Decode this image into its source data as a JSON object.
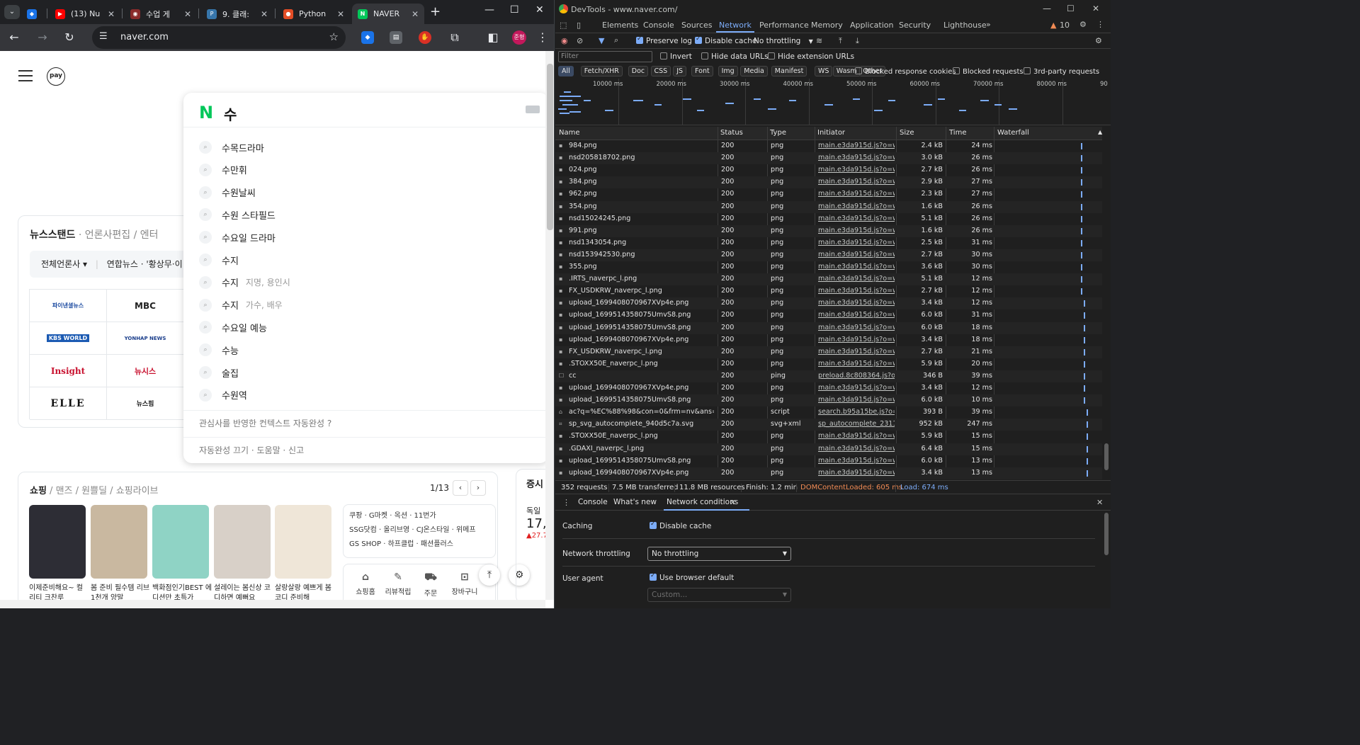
{
  "browser": {
    "tabs": [
      {
        "label": "",
        "favicon_color": "#1a73e8",
        "icon": "gem-icon"
      },
      {
        "label": "(13) Nu",
        "favicon_color": "#ff0000",
        "icon": "youtube-icon"
      },
      {
        "label": "수업 게",
        "favicon_color": "#8a2b2b",
        "icon": "site-icon"
      },
      {
        "label": "9. 클래:",
        "favicon_color": "#3776ab",
        "icon": "python-icon"
      },
      {
        "label": "Python",
        "favicon_color": "#e44d26",
        "icon": "site-icon"
      },
      {
        "label": "NAVER",
        "favicon_color": "#03c75a",
        "icon": "naver-icon"
      }
    ],
    "url": "naver.com",
    "avatar_text": "준형"
  },
  "naver": {
    "pay_logo": "pay",
    "news_title": "뉴스스탠드",
    "news_tab2": "언론사편집",
    "news_tab3": "엔터",
    "press_filter": "전체언론사 ▾",
    "press_ticker": "연합뉴스 · '황상무·이",
    "press": [
      {
        "name": "파이낸셜뉴스",
        "color": "#1b4aa0"
      },
      {
        "name": "MBC",
        "color": "#222"
      },
      {
        "name": "KBS WORLD",
        "color": "#1c5bb3"
      },
      {
        "name": "YONHAP NEWS",
        "color": "#1c3f8c"
      },
      {
        "name": "Insight",
        "color": "#c8102e"
      },
      {
        "name": "뉴시스",
        "color": "#c8102e"
      },
      {
        "name": "ELLE",
        "color": "#111"
      },
      {
        "name": "뉴스핌",
        "color": "#111"
      }
    ],
    "autocomplete": {
      "query": "수",
      "items": [
        {
          "text": "수목드라마",
          "sub": ""
        },
        {
          "text": "수만휘",
          "sub": ""
        },
        {
          "text": "수원날씨",
          "sub": ""
        },
        {
          "text": "수원 스타필드",
          "sub": ""
        },
        {
          "text": "수요일 드라마",
          "sub": ""
        },
        {
          "text": "수지",
          "sub": ""
        },
        {
          "text": "수지",
          "sub": "지명, 용인시"
        },
        {
          "text": "수지",
          "sub": "가수, 배우"
        },
        {
          "text": "수요일 예능",
          "sub": ""
        },
        {
          "text": "수능",
          "sub": ""
        },
        {
          "text": "술집",
          "sub": ""
        },
        {
          "text": "수원역",
          "sub": ""
        }
      ],
      "context_text": "관심사를 반영한 컨텍스트 자동완성 ?",
      "footer": "자동완성 끄기 · 도움말 · 신고"
    },
    "shopping": {
      "tab1": "쇼핑",
      "tab2": "맨즈",
      "tab3": "원쁠딜",
      "tab4": "쇼핑라이브",
      "pager": "1/13",
      "products": [
        {
          "caption": "이제준비해요~ 컬리티 크찬루",
          "color": "#2d2d35"
        },
        {
          "caption": "봄 준비 필수템 리브 1천개 양말",
          "color": "#c9b8a0"
        },
        {
          "caption": "백화점인기BEST 에디션만 초특가",
          "color": "#8fd3c5"
        },
        {
          "caption": "설레이는 봄신상 코디하면 예뻐요",
          "color": "#d8d0c8"
        },
        {
          "caption": "살랑살랑 예쁘게 봄코디 준비해",
          "color": "#efe6d8"
        }
      ],
      "brands_line1": "쿠팡 · G마켓 · 옥션 · 11번가",
      "brands_line2": "SSG닷컴 · 올리브영 · CJ온스타일 · 위메프",
      "brands_line3": "GS SHOP · 하프클럽 · 패션플러스",
      "shortcuts": [
        {
          "label": "쇼핑홈",
          "icon": "home-icon"
        },
        {
          "label": "리뷰적립",
          "icon": "review-icon"
        },
        {
          "label": "주문",
          "icon": "truck-icon"
        },
        {
          "label": "장바구니",
          "icon": "cart-icon"
        }
      ]
    },
    "stock": {
      "title": "증시",
      "label": "독일",
      "value": "17,9",
      "change": "▲27.7"
    }
  },
  "devtools": {
    "title": "DevTools - www.naver.com/",
    "tabs": [
      "Elements",
      "Console",
      "Sources",
      "Network",
      "Performance",
      "Memory",
      "Application",
      "Security",
      "Lighthouse"
    ],
    "active_tab": "Network",
    "warnings": "10",
    "preserve_log": "Preserve log",
    "disable_cache": "Disable cache",
    "throttling": "No throttling",
    "filter_placeholder": "Filter",
    "invert": "Invert",
    "hide_data_urls": "Hide data URLs",
    "hide_ext_urls": "Hide extension URLs",
    "filter_types": [
      "All",
      "Fetch/XHR",
      "Doc",
      "CSS",
      "JS",
      "Font",
      "Img",
      "Media",
      "Manifest",
      "WS",
      "Wasm",
      "Other"
    ],
    "blocked_cookies": "Blocked response cookies",
    "blocked_requests": "Blocked requests",
    "third_party": "3rd-party requests",
    "timeline_labels": [
      "10000 ms",
      "20000 ms",
      "30000 ms",
      "40000 ms",
      "50000 ms",
      "60000 ms",
      "70000 ms",
      "80000 ms",
      "90"
    ],
    "columns": [
      "Name",
      "Status",
      "Type",
      "Initiator",
      "Size",
      "Time",
      "Waterfall"
    ],
    "rows": [
      {
        "name": "984.png",
        "status": "200",
        "type": "png",
        "initiator": "main.e3da915d.js?o=w...",
        "size": "2.4 kB",
        "time": "24 ms"
      },
      {
        "name": "nsd205818702.png",
        "status": "200",
        "type": "png",
        "initiator": "main.e3da915d.js?o=w...",
        "size": "3.0 kB",
        "time": "26 ms"
      },
      {
        "name": "024.png",
        "status": "200",
        "type": "png",
        "initiator": "main.e3da915d.js?o=w...",
        "size": "2.7 kB",
        "time": "26 ms"
      },
      {
        "name": "384.png",
        "status": "200",
        "type": "png",
        "initiator": "main.e3da915d.js?o=w...",
        "size": "2.9 kB",
        "time": "27 ms"
      },
      {
        "name": "962.png",
        "status": "200",
        "type": "png",
        "initiator": "main.e3da915d.js?o=w...",
        "size": "2.3 kB",
        "time": "27 ms"
      },
      {
        "name": "354.png",
        "status": "200",
        "type": "png",
        "initiator": "main.e3da915d.js?o=w...",
        "size": "1.6 kB",
        "time": "26 ms"
      },
      {
        "name": "nsd15024245.png",
        "status": "200",
        "type": "png",
        "initiator": "main.e3da915d.js?o=w...",
        "size": "5.1 kB",
        "time": "26 ms"
      },
      {
        "name": "991.png",
        "status": "200",
        "type": "png",
        "initiator": "main.e3da915d.js?o=w...",
        "size": "1.6 kB",
        "time": "26 ms"
      },
      {
        "name": "nsd1343054.png",
        "status": "200",
        "type": "png",
        "initiator": "main.e3da915d.js?o=w...",
        "size": "2.5 kB",
        "time": "31 ms"
      },
      {
        "name": "nsd153942530.png",
        "status": "200",
        "type": "png",
        "initiator": "main.e3da915d.js?o=w...",
        "size": "2.7 kB",
        "time": "30 ms"
      },
      {
        "name": "355.png",
        "status": "200",
        "type": "png",
        "initiator": "main.e3da915d.js?o=w...",
        "size": "3.6 kB",
        "time": "30 ms"
      },
      {
        "name": ".IRTS_naverpc_l.png",
        "status": "200",
        "type": "png",
        "initiator": "main.e3da915d.js?o=w...",
        "size": "5.1 kB",
        "time": "12 ms"
      },
      {
        "name": "FX_USDKRW_naverpc_l.png",
        "status": "200",
        "type": "png",
        "initiator": "main.e3da915d.js?o=w...",
        "size": "2.7 kB",
        "time": "12 ms"
      },
      {
        "name": "upload_1699408070967XVp4e.png",
        "status": "200",
        "type": "png",
        "initiator": "main.e3da915d.js?o=w...",
        "size": "3.4 kB",
        "time": "12 ms"
      },
      {
        "name": "upload_1699514358075UmvS8.png",
        "status": "200",
        "type": "png",
        "initiator": "main.e3da915d.js?o=w...",
        "size": "6.0 kB",
        "time": "31 ms"
      },
      {
        "name": "upload_1699514358075UmvS8.png",
        "status": "200",
        "type": "png",
        "initiator": "main.e3da915d.js?o=w...",
        "size": "6.0 kB",
        "time": "18 ms"
      },
      {
        "name": "upload_1699408070967XVp4e.png",
        "status": "200",
        "type": "png",
        "initiator": "main.e3da915d.js?o=w...",
        "size": "3.4 kB",
        "time": "18 ms"
      },
      {
        "name": "FX_USDKRW_naverpc_l.png",
        "status": "200",
        "type": "png",
        "initiator": "main.e3da915d.js?o=w...",
        "size": "2.7 kB",
        "time": "21 ms"
      },
      {
        "name": ".STOXX50E_naverpc_l.png",
        "status": "200",
        "type": "png",
        "initiator": "main.e3da915d.js?o=w...",
        "size": "5.9 kB",
        "time": "20 ms"
      },
      {
        "name": "cc",
        "status": "200",
        "type": "ping",
        "initiator": "preload.8c808364.js?o...",
        "size": "346 B",
        "time": "39 ms"
      },
      {
        "name": "upload_1699408070967XVp4e.png",
        "status": "200",
        "type": "png",
        "initiator": "main.e3da915d.js?o=w...",
        "size": "3.4 kB",
        "time": "12 ms"
      },
      {
        "name": "upload_1699514358075UmvS8.png",
        "status": "200",
        "type": "png",
        "initiator": "main.e3da915d.js?o=w...",
        "size": "6.0 kB",
        "time": "10 ms"
      },
      {
        "name": "ac?q=%EC%88%98&con=0&frm=nv&ans=2...",
        "status": "200",
        "type": "script",
        "initiator": "search.b95a15be.js?o=...",
        "size": "393 B",
        "time": "39 ms"
      },
      {
        "name": "sp_svg_autocomplete_940d5c7a.svg",
        "status": "200",
        "type": "svg+xml",
        "initiator": "sp_autocomplete_2311...",
        "size": "952 kB",
        "time": "247 ms"
      },
      {
        "name": ".STOXX50E_naverpc_l.png",
        "status": "200",
        "type": "png",
        "initiator": "main.e3da915d.js?o=w...",
        "size": "5.9 kB",
        "time": "15 ms"
      },
      {
        "name": ".GDAXI_naverpc_l.png",
        "status": "200",
        "type": "png",
        "initiator": "main.e3da915d.js?o=w...",
        "size": "6.4 kB",
        "time": "15 ms"
      },
      {
        "name": "upload_1699514358075UmvS8.png",
        "status": "200",
        "type": "png",
        "initiator": "main.e3da915d.js?o=w...",
        "size": "6.0 kB",
        "time": "13 ms"
      },
      {
        "name": "upload_1699408070967XVp4e.png",
        "status": "200",
        "type": "png",
        "initiator": "main.e3da915d.js?o=w...",
        "size": "3.4 kB",
        "time": "13 ms"
      }
    ],
    "summary": {
      "requests": "352 requests",
      "transferred": "7.5 MB transferred",
      "resources": "11.8 MB resources",
      "finish": "Finish: 1.2 min",
      "dcl": "DOMContentLoaded: 605 ms",
      "load": "Load: 674 ms",
      "dcl_color": "#f28b54",
      "load_color": "#7cacf8"
    },
    "drawer": {
      "tabs": [
        "Console",
        "What's new",
        "Network conditions"
      ],
      "active": "Network conditions",
      "caching_label": "Caching",
      "caching_value": "Disable cache",
      "throttling_label": "Network throttling",
      "throttling_value": "No throttling",
      "ua_label": "User agent",
      "ua_value": "Use browser default",
      "ua_custom_placeholder": "Custom..."
    }
  }
}
